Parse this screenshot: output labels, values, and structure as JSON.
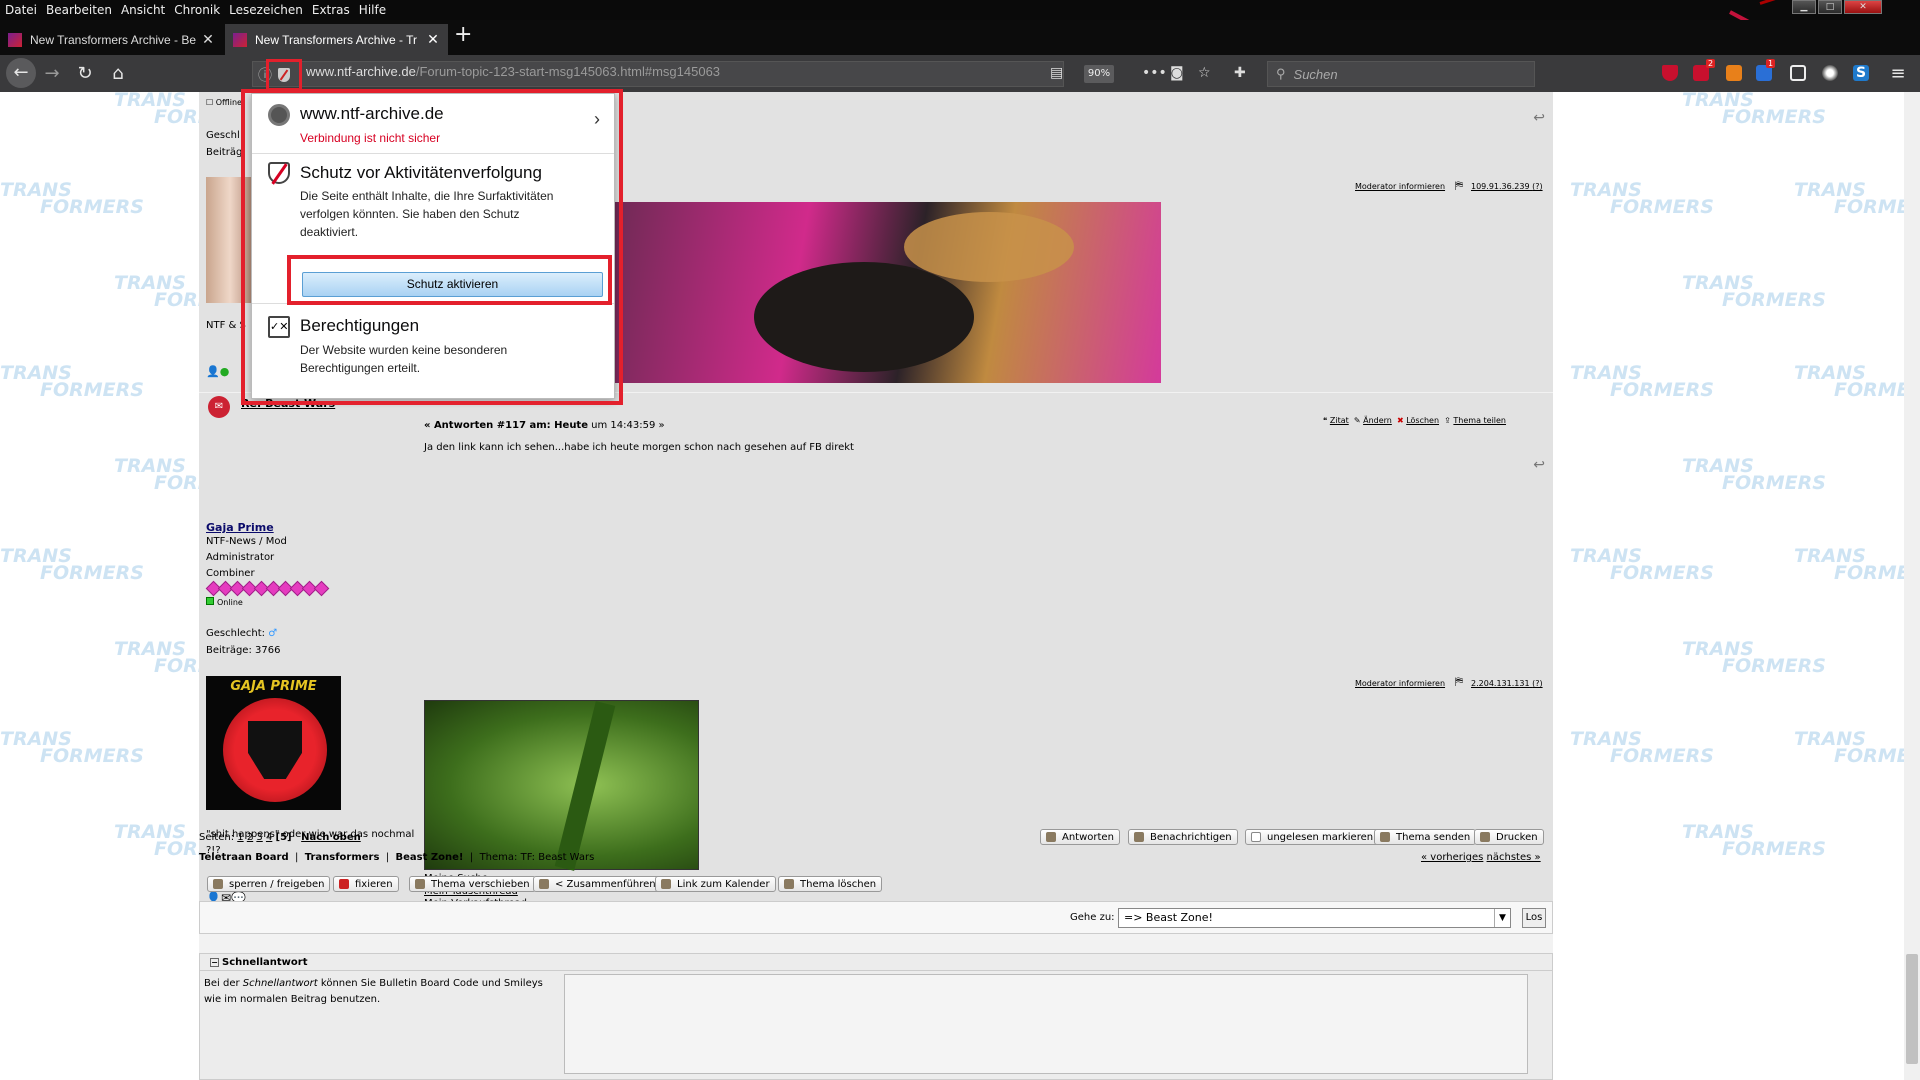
{
  "menubar": {
    "items": [
      "Datei",
      "Bearbeiten",
      "Ansicht",
      "Chronik",
      "Lesezeichen",
      "Extras",
      "Hilfe"
    ]
  },
  "tabs": [
    {
      "title": "New Transformers Archive - Be",
      "active": false
    },
    {
      "title": "New Transformers Archive - Tr",
      "active": true
    }
  ],
  "navbar": {
    "url_host": "www.ntf-archive.de",
    "url_path": "/Forum-topic-123-start-msg145063.html#msg145063",
    "zoom": "90%",
    "search_placeholder": "Suchen",
    "badges": {
      "adblock": "2",
      "notify": "1"
    }
  },
  "popup": {
    "site": "www.ntf-archive.de",
    "site_status": "Verbindung ist nicht sicher",
    "tracking_title": "Schutz vor Aktivitätenverfolgung",
    "tracking_text": [
      "Die Seite enthält Inhalte, die Ihre Surfaktivitäten",
      "verfolgen könnten. Sie haben den Schutz",
      "deaktiviert."
    ],
    "tracking_button": "Schutz aktivieren",
    "perm_title": "Berechtigungen",
    "perm_text": [
      "Der Website wurden keine besonderen",
      "Berechtigungen erteilt."
    ]
  },
  "post1": {
    "offline_label": "Offline",
    "gender_prefix": "Geschl",
    "posts_prefix": "Beiträg",
    "moderator_link": "Moderator informieren",
    "ip": "109.91.36.239",
    "ip_help": "(?)",
    "signature_prefix": "NTF & S"
  },
  "post2": {
    "subject": "Re: Beast Wars",
    "author": "Gaja Prime",
    "role1": "NTF-News / Mod",
    "role2": "Administrator",
    "rank": "Combiner",
    "online": "Online",
    "gender_label": "Geschlecht:",
    "posts_label": "Beiträge: 3766",
    "header_bold": "« Antworten #117 am: Heute",
    "header_rest": " um 14:43:59 »",
    "actions": [
      "Zitat",
      "Ändern",
      "Löschen",
      "Thema teilen"
    ],
    "body": "Ja den link kann ich sehen...habe ich heute morgen schon nach gesehen auf FB direkt",
    "moderator_link": "Moderator informieren",
    "ip": "2.204.131.131",
    "ip_help": "(?)",
    "avatar_text": "GAJA PRIME",
    "quote": "\"shit happens\" oder wie war das nochmal ?!?",
    "links": [
      "Meine Suche",
      "Mein Tauschthread",
      "Mein Verkaufsthread"
    ]
  },
  "pagination": {
    "label": "Seiten:",
    "pages": [
      "1",
      "2",
      "3",
      "4"
    ],
    "current": "[5]",
    "top_link": "Nach oben"
  },
  "thread_buttons": [
    "Antworten",
    "Benachrichtigen",
    "ungelesen markieren",
    "Thema senden",
    "Drucken"
  ],
  "breadcrumb": {
    "board": "Teletraan Board",
    "cat": "Transformers",
    "sub": "Beast Zone!",
    "topic_label": "Thema: TF: Beast Wars",
    "prev": "« vorheriges",
    "next": "nächstes »"
  },
  "mod_buttons": [
    "sperren / freigeben",
    "fixieren",
    "Thema verschieben",
    "< Zusammenführen",
    "Link zum Kalender",
    "Thema löschen"
  ],
  "jump": {
    "label": "Gehe zu:",
    "selected": "=> Beast Zone!",
    "go": "Los"
  },
  "quickreply": {
    "title": "Schnellantwort",
    "text_pre": "Bei der ",
    "text_em": "Schnellantwort",
    "text_post": " können Sie Bulletin Board Code und Smileys wie im normalen Beitrag benutzen."
  },
  "watermark": {
    "line1": "TRANS",
    "line2": "FORMERS"
  },
  "colors": {
    "alert": "#e3202c",
    "insecure": "#d70022",
    "accent_pink": "#e53cbf"
  }
}
